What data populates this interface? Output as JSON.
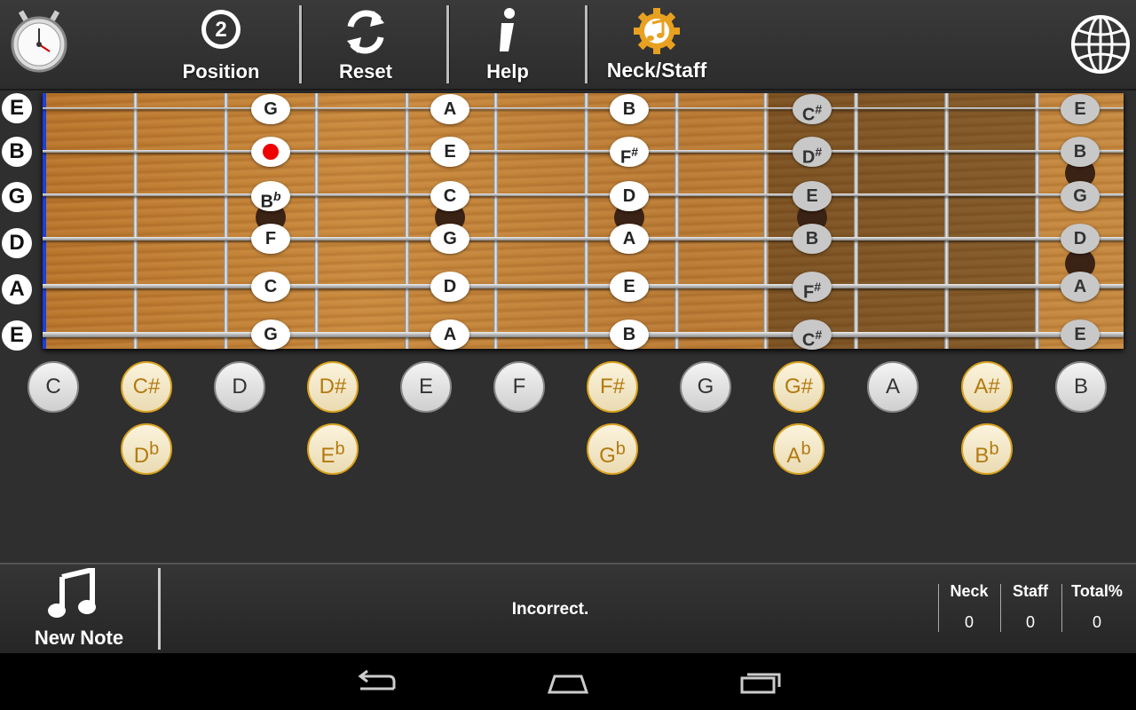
{
  "toolbar": {
    "position_label": "Position",
    "position_value": "2",
    "reset_label": "Reset",
    "help_label": "Help",
    "neck_staff_label": "Neck/Staff"
  },
  "strings": [
    "E",
    "B",
    "G",
    "D",
    "A",
    "E"
  ],
  "fretboard_notes": {
    "fret3": [
      "G",
      "",
      "B",
      "F",
      "C",
      "G"
    ],
    "fret5": [
      "A",
      "E",
      "C",
      "G",
      "D",
      "A"
    ],
    "fret7": [
      "B",
      "F",
      "D",
      "A",
      "E",
      "B"
    ],
    "fret9": [
      "C",
      "D",
      "E",
      "B",
      "F",
      "C"
    ],
    "fret12": [
      "E",
      "B",
      "G",
      "D",
      "A",
      "E"
    ]
  },
  "answers_row1": [
    "C",
    "C#",
    "D",
    "D#",
    "E",
    "F",
    "F#",
    "G",
    "G#",
    "A",
    "A#",
    "B"
  ],
  "answers_row2": [
    "D",
    "E",
    "G",
    "A",
    "B"
  ],
  "sharp_symbol": "#",
  "flat_symbol": "b",
  "bottom": {
    "new_note_label": "New Note",
    "status": "Incorrect.",
    "scores": [
      {
        "header": "Neck",
        "value": "0"
      },
      {
        "header": "Staff",
        "value": "0"
      },
      {
        "header": "Total%",
        "value": "0"
      }
    ]
  },
  "colors": {
    "accent": "#d8a11e",
    "nut": "#1f3fd8",
    "marker": "#e00000"
  }
}
